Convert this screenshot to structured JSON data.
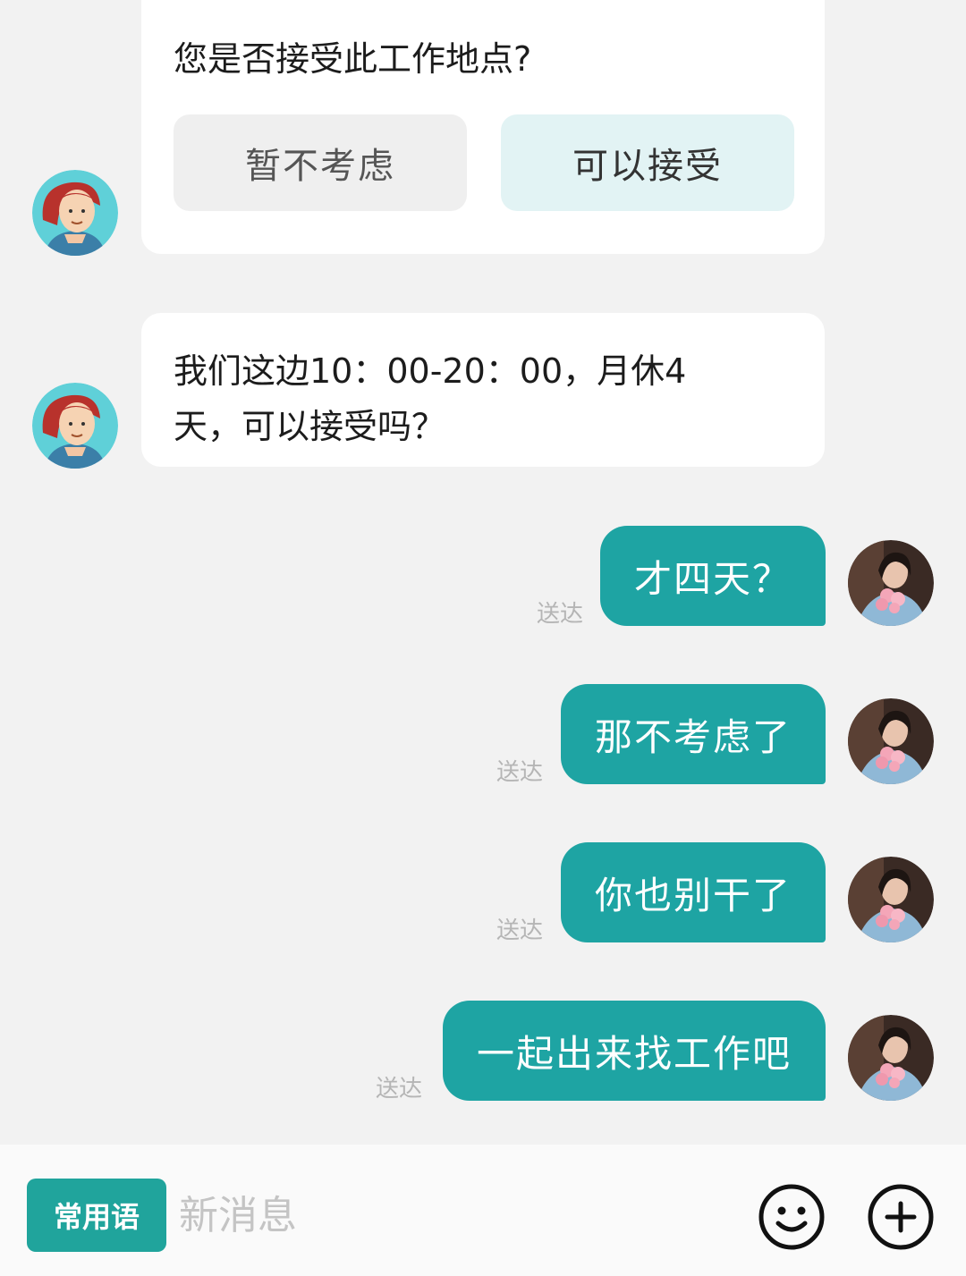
{
  "conversation": {
    "question_card": {
      "question": "您是否接受此工作地点?",
      "option_decline": "暂不考虑",
      "option_accept": "可以接受"
    },
    "schedule_message": {
      "line1": "我们这边10：00-20：00，月休4",
      "line2": "天，可以接受吗？"
    },
    "sent_messages": [
      {
        "text": "才四天？",
        "status": "送达"
      },
      {
        "text": "那不考虑了",
        "status": "送达"
      },
      {
        "text": "你也别干了",
        "status": "送达"
      },
      {
        "text": "一起出来找工作吧",
        "status": "送达"
      }
    ]
  },
  "composer": {
    "phrases_label": "常用语",
    "input_placeholder": "新消息",
    "emoji_icon": "smiley-icon",
    "more_icon": "plus-circle-icon"
  },
  "colors": {
    "accent": "#1ea4a3",
    "background": "#f2f2f2",
    "accept_option_bg": "#e2f3f4"
  }
}
